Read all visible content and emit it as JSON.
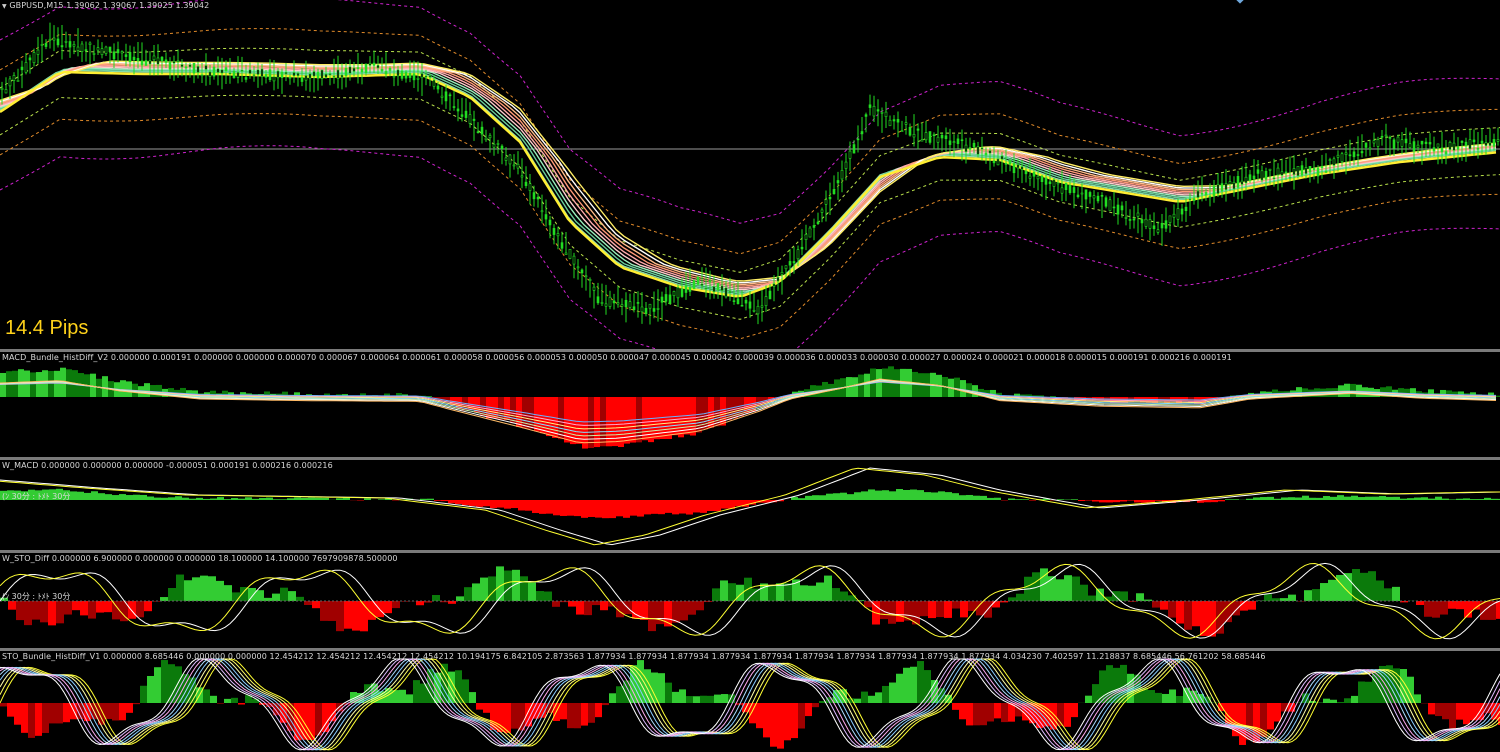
{
  "main_chart": {
    "title": "GBPUSD,M15  1.39062 1.39067 1.39025 1.39042",
    "pips_label": "14.4 Pips",
    "price_line_y": 149
  },
  "panes": [
    {
      "id": "macd-bundle",
      "label": "MACD_Bundle_HistDiff_V2 0.000000 0.000191 0.000000 0.000000 0.000070 0.000067 0.000064 0.000061 0.000058 0.000056 0.000053 0.000050 0.000047 0.000045 0.000042 0.000039 0.000036 0.000033 0.000030 0.000027 0.000024 0.000021 0.000018 0.000015 0.000191 0.000216 0.000191"
    },
    {
      "id": "mtf-macd",
      "label": "W_MACD 0.000000 0.000000 0.000000 -0.000051 0.000191 0.000216 0.000216",
      "sublabel": "(ﾝ 30分 : ﾄﾒﾄ  30分"
    },
    {
      "id": "sto-diff",
      "label": "W_STO_Diff 0.000000 6.900000 0.000000 0.000000 18.100000 14.100000 7697909878.500000",
      "sublabel": "(ﾝ 30分 : ﾄﾒﾄ  30分"
    },
    {
      "id": "sto-bundle",
      "label": "STO_Bundle_HistDiff_V1 0.000000 8.685446 0.000000 0.000000 12.454212 12.454212 12.454212 12.454212 10.194175 6.842105 2.873563 1.877934 1.877934 1.877934 1.877934 1.877934 1.877934 1.877934 1.877934 1.877934 1.877934 4.034230 7.402597 11.218837 8.685446 56.761202 58.685446"
    }
  ],
  "colors": {
    "bull_candle": "#22dd22",
    "bull_hist": "#33cc33",
    "bull_hist_dark": "#0b7a0b",
    "bear_hist": "#ff0000",
    "bear_hist_dark": "#a00000",
    "signal_yellow": "#ffff33",
    "signal_white": "#ffffff",
    "band_magenta": "#cc22cc",
    "band_orange": "#e08a2a",
    "band_green": "#b8e04a",
    "price_line": "#9a9a9a",
    "pips_text": "#ffd21a"
  },
  "icons": {
    "menu": "triangle-down-icon",
    "corner": "diamond-icon"
  }
}
